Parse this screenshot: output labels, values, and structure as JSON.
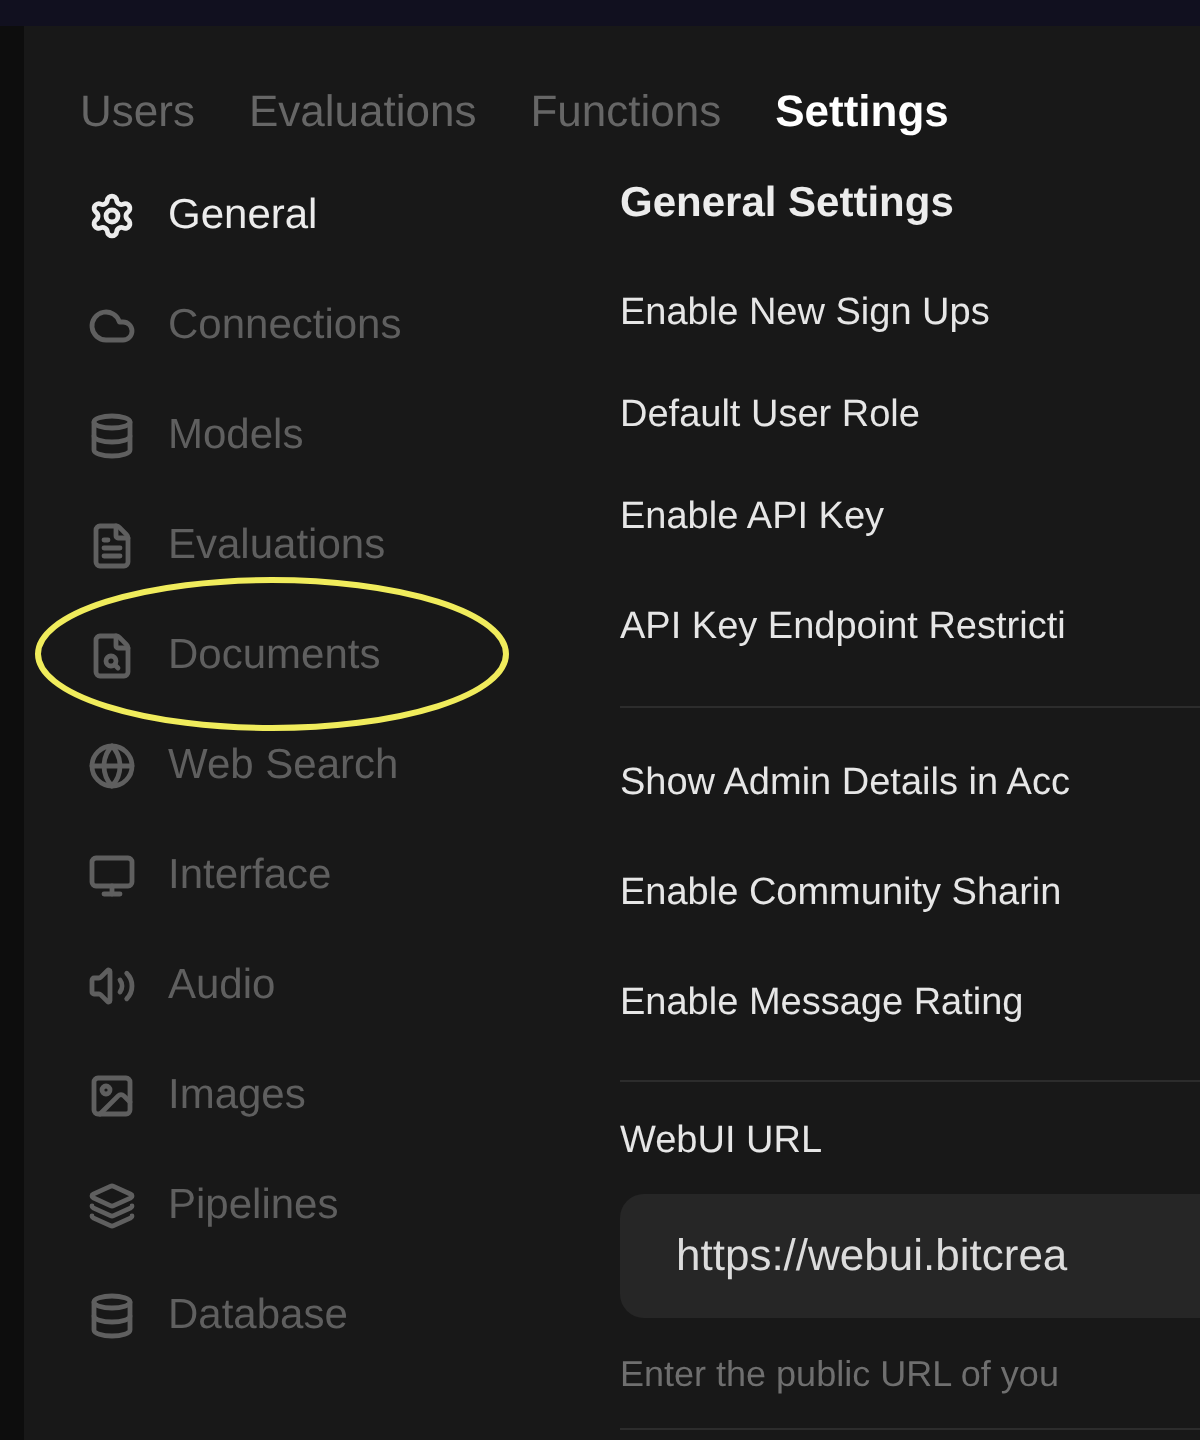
{
  "tabs": [
    {
      "label": "Users",
      "selected": false
    },
    {
      "label": "Evaluations",
      "selected": false
    },
    {
      "label": "Functions",
      "selected": false
    },
    {
      "label": "Settings",
      "selected": true
    }
  ],
  "sidebar": {
    "items": [
      {
        "label": "General",
        "kind": "gear",
        "selected": true
      },
      {
        "label": "Connections",
        "kind": "cloud",
        "selected": false
      },
      {
        "label": "Models",
        "kind": "database",
        "selected": false
      },
      {
        "label": "Evaluations",
        "kind": "file",
        "selected": false
      },
      {
        "label": "Documents",
        "kind": "file-search",
        "selected": false
      },
      {
        "label": "Web Search",
        "kind": "globe",
        "selected": false
      },
      {
        "label": "Interface",
        "kind": "monitor",
        "selected": false
      },
      {
        "label": "Audio",
        "kind": "speaker",
        "selected": false
      },
      {
        "label": "Images",
        "kind": "image",
        "selected": false
      },
      {
        "label": "Pipelines",
        "kind": "layers",
        "selected": false
      },
      {
        "label": "Database",
        "kind": "database",
        "selected": false
      }
    ]
  },
  "settings": {
    "title": "General Settings",
    "sections": [
      {
        "rows": [
          "Enable New Sign Ups",
          "Default User Role",
          "Enable API Key",
          "API Key Endpoint Restricti"
        ]
      },
      {
        "rows": [
          "Show Admin Details in Acc",
          "Enable Community Sharin",
          "Enable Message Rating"
        ]
      }
    ],
    "webui_url": {
      "label": "WebUI URL",
      "value": "https://webui.bitcrea",
      "hint": "Enter the public URL of you"
    }
  }
}
